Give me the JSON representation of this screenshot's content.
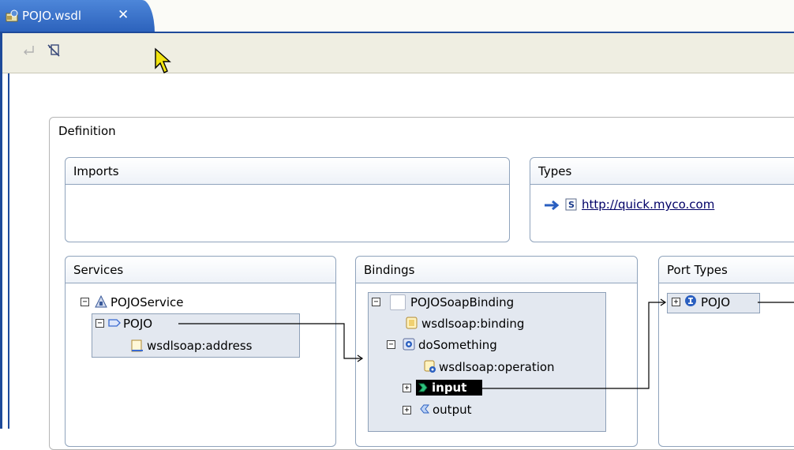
{
  "editor": {
    "tab_label": "POJO.wsdl",
    "close_glyph": "✕"
  },
  "toolbar": {
    "buttons": [
      {
        "icon": "back-arrow-icon",
        "enabled": false
      },
      {
        "icon": "no-link-icon",
        "enabled": true
      }
    ]
  },
  "definition": {
    "title": "Definition"
  },
  "imports": {
    "title": "Imports"
  },
  "types": {
    "title": "Types",
    "schema_link": "http://quick.myco.com"
  },
  "services": {
    "title": "Services",
    "service_name": "POJOService",
    "port_name": "POJO",
    "address": "wsdlsoap:address"
  },
  "bindings": {
    "title": "Bindings",
    "binding_name": "POJOSoapBinding",
    "soap_binding": "wsdlsoap:binding",
    "operation": "doSomething",
    "soap_operation": "wsdlsoap:operation",
    "input": "input",
    "output": "output"
  },
  "port_types": {
    "title": "Port Types",
    "port_type": "POJO"
  },
  "colors": {
    "tab_blue": "#2b61bb",
    "frame_blue": "#1e4a9a",
    "toolbar_bg": "#efeee2",
    "box_border": "#8fa3bc",
    "selection_bg": "#e3e8f0"
  }
}
